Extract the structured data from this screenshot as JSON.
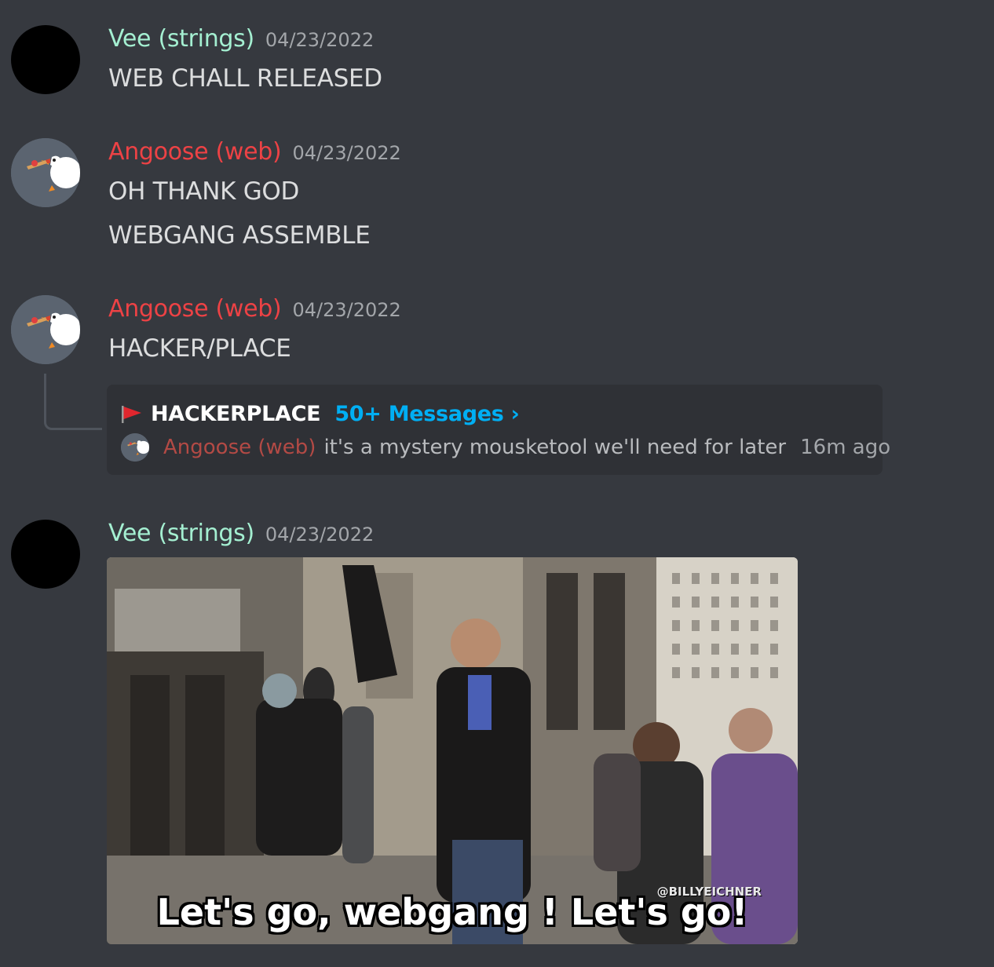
{
  "colors": {
    "background": "#36393f",
    "vee_name": "#a4efd1",
    "angoose_name": "#ed4245",
    "thread_count": "#00aff4",
    "thread_card": "#2f3136"
  },
  "messages": [
    {
      "author": "Vee (strings)",
      "timestamp": "04/23/2022",
      "lines": [
        "WEB CHALL RELEASED"
      ]
    },
    {
      "author": "Angoose (web)",
      "timestamp": "04/23/2022",
      "lines": [
        "OH THANK GOD",
        "WEBGANG ASSEMBLE"
      ]
    },
    {
      "author": "Angoose (web)",
      "timestamp": "04/23/2022",
      "lines": [
        "HACKER/PLACE"
      ],
      "thread": {
        "icon": "red-flag-icon",
        "name": "HACKERPLACE",
        "count_label": "50+ Messages ›",
        "preview_author": "Angoose (web)",
        "preview_text": "it's a mystery mousketool we'll need for later",
        "preview_time": "16m ago"
      }
    },
    {
      "author": "Vee (strings)",
      "timestamp": "04/23/2022",
      "gif": {
        "caption": "Let's go, webgang ! Let's go!",
        "watermark": "@BILLYEICHNER"
      }
    }
  ]
}
